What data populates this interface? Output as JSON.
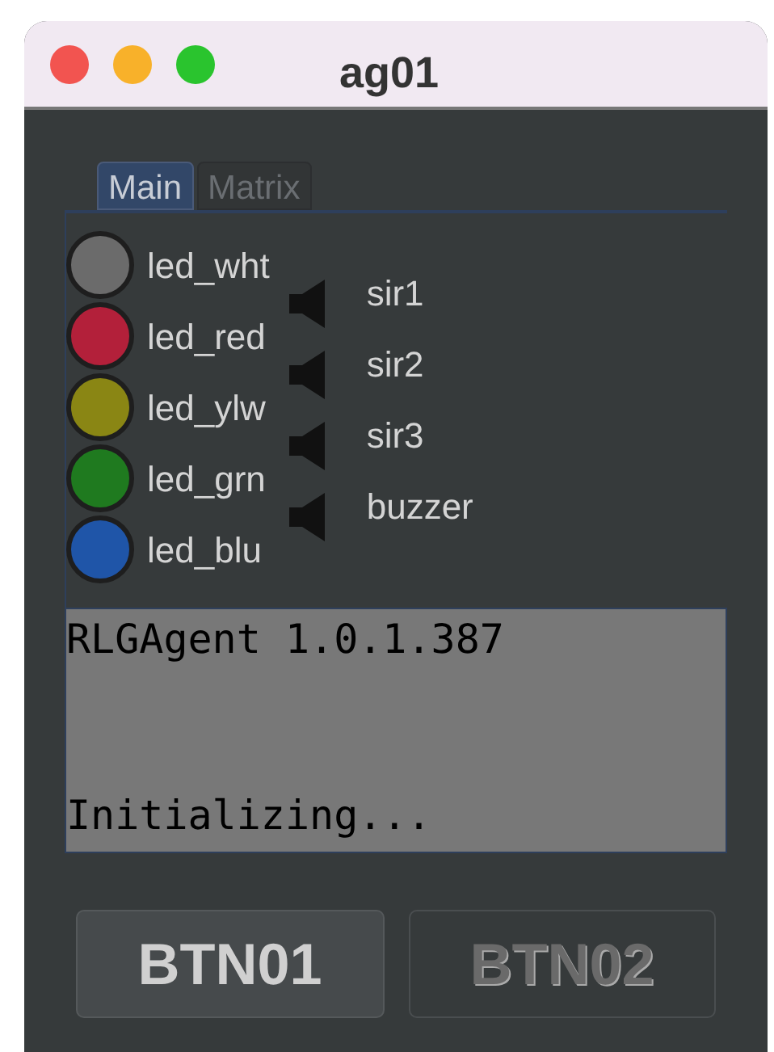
{
  "window": {
    "title": "ag01"
  },
  "tabs": [
    {
      "label": "Main",
      "selected": true
    },
    {
      "label": "Matrix",
      "selected": false
    }
  ],
  "leds": [
    {
      "label": "led_wht",
      "color": "#6b6b6b"
    },
    {
      "label": "led_red",
      "color": "#b3203a"
    },
    {
      "label": "led_ylw",
      "color": "#8a8614"
    },
    {
      "label": "led_grn",
      "color": "#1f7a1f"
    },
    {
      "label": "led_blu",
      "color": "#1f55a8"
    }
  ],
  "sirens": [
    {
      "label": "sir1"
    },
    {
      "label": "sir2"
    },
    {
      "label": "sir3"
    },
    {
      "label": "buzzer"
    }
  ],
  "console": {
    "version_line": "RLGAgent 1.0.1.387",
    "status_line": "Initializing..."
  },
  "buttons": [
    {
      "label": "BTN01",
      "disabled": false
    },
    {
      "label": "BTN02",
      "disabled": true
    }
  ]
}
